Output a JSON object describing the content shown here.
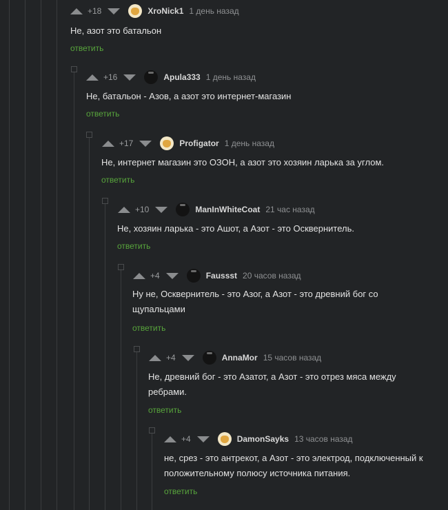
{
  "comments": [
    {
      "rating": "+18",
      "user": "XroNick1",
      "time": "1 день назад",
      "avatar": "light-avatar",
      "text": "Не, азот это батальон",
      "reply": "ответить"
    },
    {
      "rating": "+16",
      "user": "Apula333",
      "time": "1 день назад",
      "avatar": "dark-avatar",
      "text": "Не, батальон - Азов, а азот это интернет-магазин",
      "reply": "ответить"
    },
    {
      "rating": "+17",
      "user": "Profigator",
      "time": "1 день назад",
      "avatar": "light-avatar",
      "text": "Не, интернет магазин это ОЗОН, а азот это хозяин ларька за углом.",
      "reply": "ответить"
    },
    {
      "rating": "+10",
      "user": "ManInWhiteCoat",
      "time": "21 час назад",
      "avatar": "dark-avatar",
      "text": "Не, хозяин ларька - это Ашот, а Азот - это Осквернитель.",
      "reply": "ответить"
    },
    {
      "rating": "+4",
      "user": "Faussst",
      "time": "20 часов назад",
      "avatar": "dark-avatar",
      "text": "Ну не, Осквернитель - это Азог, а Азот - это древний бог со\nщупальцами",
      "reply": "ответить"
    },
    {
      "rating": "+4",
      "user": "AnnaMor",
      "time": "15 часов назад",
      "avatar": "dark-avatar",
      "text": "Не, древний бог - это Азатот, а Азот - это отрез мяса между\nребрами.",
      "reply": "ответить"
    },
    {
      "rating": "+4",
      "user": "DamonSayks",
      "time": "13 часов назад",
      "avatar": "light-avatar",
      "text": "не, срез - это антрекот, а Азот - это электрод, подключенный к\nположительному полюсу источника питания.",
      "reply": "ответить"
    }
  ],
  "colors": {
    "background": "#222426",
    "reply_link": "#58a53c",
    "thread_line": "#3a3c3e"
  }
}
